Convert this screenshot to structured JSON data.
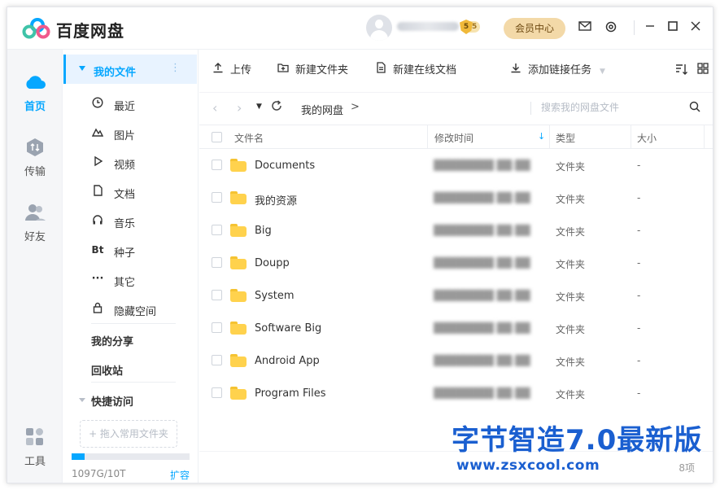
{
  "app": {
    "brand": "百度网盘"
  },
  "header": {
    "level": "5",
    "vip_label": "会员中心",
    "icons": [
      "mail-icon",
      "settings-icon",
      "minimize-icon",
      "maximize-icon",
      "close-icon"
    ]
  },
  "leftnav": [
    {
      "label": "首页",
      "icon": "cloud-icon",
      "active": true
    },
    {
      "label": "传输",
      "icon": "transfer-icon",
      "active": false
    },
    {
      "label": "好友",
      "icon": "friends-icon",
      "active": false
    },
    {
      "label": "工具",
      "icon": "tools-icon",
      "active": false
    }
  ],
  "sidebar": {
    "my_files": "我的文件",
    "more": "⋮",
    "items": [
      {
        "label": "最近",
        "icon": "clock-icon"
      },
      {
        "label": "图片",
        "icon": "image-icon"
      },
      {
        "label": "视频",
        "icon": "video-icon"
      },
      {
        "label": "文档",
        "icon": "document-icon"
      },
      {
        "label": "音乐",
        "icon": "headphones-icon"
      },
      {
        "label": "种子",
        "icon": "bt-icon",
        "glyph": "Bt"
      },
      {
        "label": "其它",
        "icon": "more-icon"
      },
      {
        "label": "隐藏空间",
        "icon": "lock-icon"
      }
    ],
    "my_share": "我的分享",
    "recycle": "回收站",
    "quick_access": "快捷访问",
    "drop_hint": "+ 拖入常用文件夹",
    "quota_text": "1097G/10T",
    "quota_fraction": 0.107,
    "expand": "扩容"
  },
  "toolbar": {
    "upload": "上传",
    "new_folder": "新建文件夹",
    "new_doc": "新建在线文档",
    "add_link": "添加链接任务"
  },
  "path": {
    "crumb": "我的网盘",
    "search_placeholder": "搜索我的网盘文件"
  },
  "table": {
    "headers": {
      "name": "文件名",
      "modified": "修改时间",
      "type": "类型",
      "size": "大小"
    },
    "rows": [
      {
        "name": "Documents",
        "type": "文件夹",
        "size": "-"
      },
      {
        "name": "我的资源",
        "type": "文件夹",
        "size": "-"
      },
      {
        "name": "Big",
        "type": "文件夹",
        "size": "-"
      },
      {
        "name": "Doupp",
        "type": "文件夹",
        "size": "-"
      },
      {
        "name": "System",
        "type": "文件夹",
        "size": "-"
      },
      {
        "name": "Software Big",
        "type": "文件夹",
        "size": "-"
      },
      {
        "name": "Android App",
        "type": "文件夹",
        "size": "-"
      },
      {
        "name": "Program Files",
        "type": "文件夹",
        "size": "-"
      }
    ],
    "count": "8项"
  },
  "watermark": {
    "title": "字节智造7.0最新版",
    "url": "www.zsxcool.com"
  },
  "colors": {
    "accent": "#06a7ff",
    "folder": "#ffd24d",
    "vip": "#f3d9a8"
  }
}
